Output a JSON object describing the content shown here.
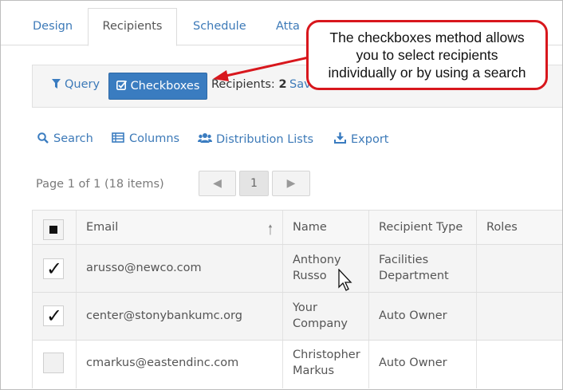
{
  "tabs": [
    {
      "label": "Design"
    },
    {
      "label": "Recipients"
    },
    {
      "label": "Schedule"
    },
    {
      "label": "Atta"
    }
  ],
  "toolbar": {
    "query_label": "Query",
    "checkboxes_label": "Checkboxes",
    "recipients_prefix": "Recipients:",
    "recipients_count": "2",
    "save_label": "Sav"
  },
  "callout": {
    "line1": "The checkboxes method allows",
    "line2": "you to select recipients",
    "line3": "individually or by using a search"
  },
  "actions": {
    "search": "Search",
    "columns": "Columns",
    "distribution_lists": "Distribution Lists",
    "export": "Export"
  },
  "pager": {
    "info": "Page 1 of 1 (18 items)",
    "current_page": "1"
  },
  "table": {
    "headers": {
      "email": "Email",
      "name": "Name",
      "recipient_type": "Recipient Type",
      "roles": "Roles"
    },
    "rows": [
      {
        "checked": true,
        "email": "arusso@newco.com",
        "name_l1": "Anthony",
        "name_l2": "Russo",
        "type_l1": "Facilities",
        "type_l2": "Department"
      },
      {
        "checked": true,
        "email": "center@stonybankumc.org",
        "name_l1": "Your",
        "name_l2": "Company",
        "type_l1": "Auto Owner",
        "type_l2": ""
      },
      {
        "checked": false,
        "email": "cmarkus@eastendinc.com",
        "name_l1": "Christopher",
        "name_l2": "Markus",
        "type_l1": "Auto Owner",
        "type_l2": ""
      }
    ]
  },
  "colors": {
    "accent": "#3a7cc0",
    "link": "#3d7ab8",
    "callout_border": "#d8171d"
  }
}
